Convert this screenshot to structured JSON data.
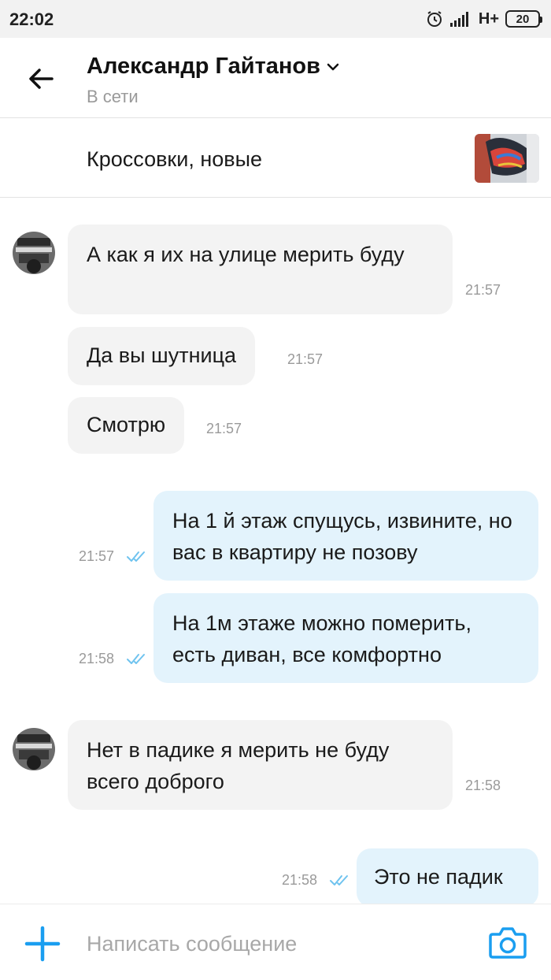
{
  "status_bar": {
    "time": "22:02",
    "network": "H+",
    "battery": "20"
  },
  "header": {
    "name": "Александр Гайтанов",
    "status": "В сети"
  },
  "item": {
    "title": "Кроссовки, новые"
  },
  "messages": [
    {
      "direction": "in",
      "text": "А как я их на улице мерить буду",
      "time": "21:57"
    },
    {
      "direction": "in",
      "text": "Да вы шутница",
      "time": "21:57"
    },
    {
      "direction": "in",
      "text": "Смотрю",
      "time": "21:57"
    },
    {
      "direction": "out",
      "text": "На 1 й этаж спущусь, извините, но вас в квартиру не позову",
      "time": "21:57",
      "read": true
    },
    {
      "direction": "out",
      "text": "На 1м этаже можно померить, есть диван, все комфортно",
      "time": "21:58",
      "read": true
    },
    {
      "direction": "in",
      "text": "Нет в падике я мерить не буду всего доброго",
      "time": "21:58"
    },
    {
      "direction": "out",
      "text": "Это не падик",
      "time": "21:58",
      "read": true
    }
  ],
  "composer": {
    "placeholder": "Написать сообщение"
  },
  "colors": {
    "accent": "#1a9ef0",
    "incoming_bubble": "#f3f3f3",
    "outgoing_bubble": "#e3f3fc",
    "read_ticks": "#6fc3ef"
  },
  "icons": {
    "back": "arrow-left-icon",
    "dropdown": "chevron-down-icon",
    "attach": "plus-icon",
    "camera": "camera-icon",
    "read": "double-check-icon",
    "alarm": "alarm-icon",
    "signal": "signal-icon"
  }
}
